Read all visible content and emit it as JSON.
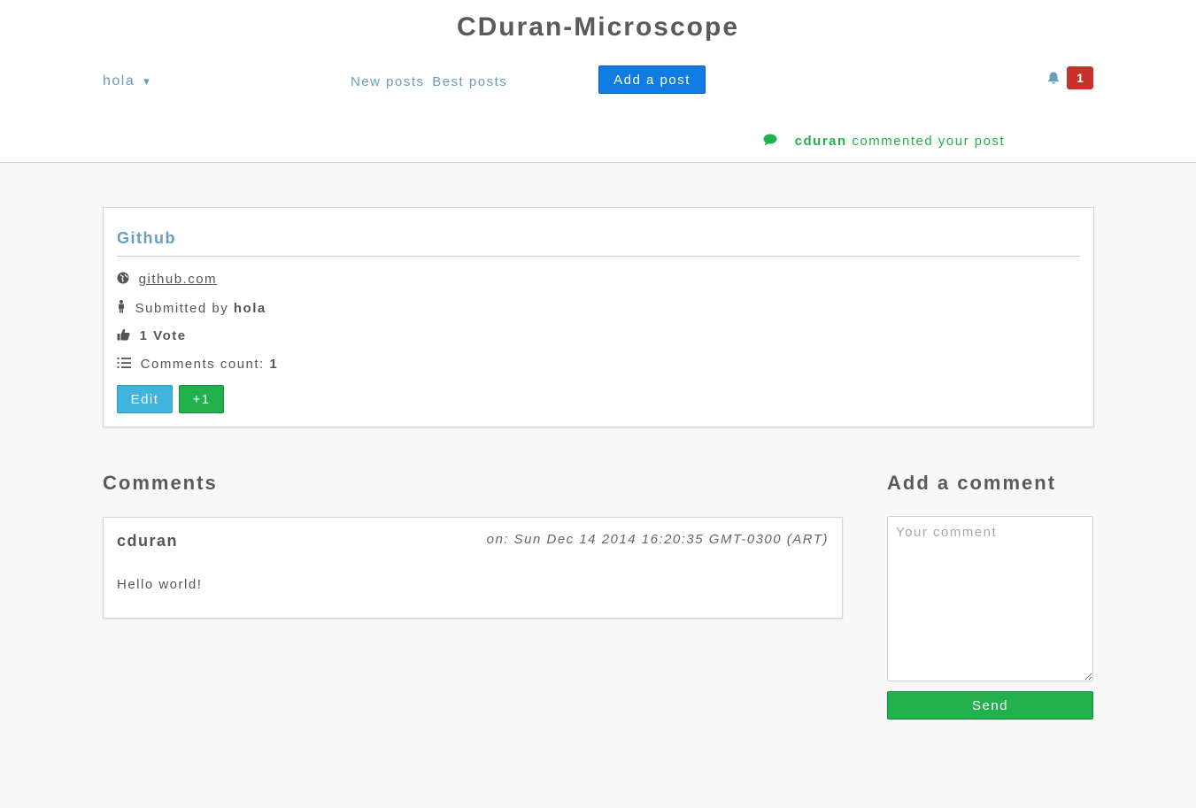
{
  "header": {
    "site_title": "CDuran-Microscope",
    "user_menu_label": "hola",
    "user_menu_caret": "▾",
    "nav": {
      "new_posts": "New posts",
      "best_posts": "Best posts"
    },
    "add_post_label": "Add a post",
    "notification_count": "1",
    "notification": {
      "icon": "comment-icon",
      "user": "cduran",
      "text": "commented your post"
    }
  },
  "post": {
    "title": "Github",
    "url": "github.com",
    "submitted_by_label": "Submitted by",
    "author": "hola",
    "votes_label": "1 Vote",
    "comments_count_label": "Comments count:",
    "comments_count": "1",
    "edit_label": "Edit",
    "upvote_label": "+1"
  },
  "comments": {
    "heading": "Comments",
    "items": [
      {
        "author": "cduran",
        "date": "on: Sun Dec 14 2014 16:20:35 GMT-0300 (ART)",
        "body": "Hello world!"
      }
    ]
  },
  "add_comment": {
    "heading": "Add a comment",
    "placeholder": "Your comment",
    "send_label": "Send"
  },
  "colors": {
    "link": "#6a9cbc",
    "primary": "#0f7be3",
    "success": "#22b14c",
    "info": "#3fb5dc",
    "danger": "#c9302c"
  }
}
